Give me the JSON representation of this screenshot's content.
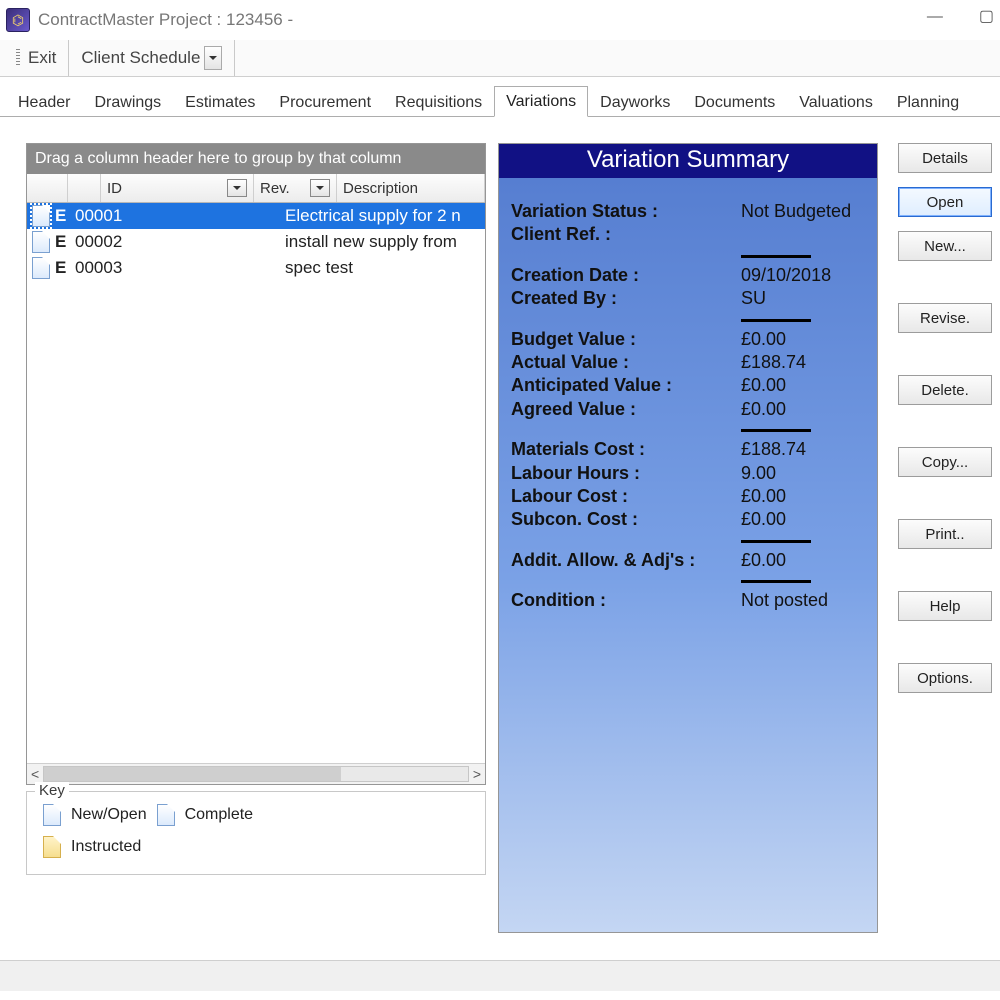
{
  "window": {
    "title": "ContractMaster Project : 123456 -"
  },
  "toolbar": {
    "exit": "Exit",
    "client_schedule": "Client Schedule"
  },
  "tabs": [
    {
      "label": "Header",
      "active": false
    },
    {
      "label": "Drawings",
      "active": false
    },
    {
      "label": "Estimates",
      "active": false
    },
    {
      "label": "Procurement",
      "active": false
    },
    {
      "label": "Requisitions",
      "active": false
    },
    {
      "label": "Variations",
      "active": true
    },
    {
      "label": "Dayworks",
      "active": false
    },
    {
      "label": "Documents",
      "active": false
    },
    {
      "label": "Valuations",
      "active": false
    },
    {
      "label": "Planning",
      "active": false
    }
  ],
  "grid": {
    "group_hint": "Drag a column header here to group by that column",
    "headers": {
      "id": "ID",
      "rev": "Rev.",
      "desc": "Description"
    },
    "rows": [
      {
        "type": "E",
        "id": "00001",
        "desc": "Electrical supply for 2 n",
        "selected": true
      },
      {
        "type": "E",
        "id": "00002",
        "desc": "install new supply from",
        "selected": false
      },
      {
        "type": "E",
        "id": "00003",
        "desc": "spec test",
        "selected": false
      }
    ]
  },
  "key": {
    "legend": "Key",
    "entries": {
      "new_open": "New/Open",
      "complete": "Complete",
      "instructed": "Instructed"
    }
  },
  "summary": {
    "title": "Variation Summary",
    "fields": {
      "status_label": "Variation Status :",
      "status_value": "Not Budgeted",
      "client_ref_label": "Client Ref. :",
      "client_ref_value": "",
      "creation_date_label": "Creation Date :",
      "creation_date_value": "09/10/2018",
      "created_by_label": "Created By :",
      "created_by_value": "SU",
      "budget_value_label": "Budget Value :",
      "budget_value_value": "£0.00",
      "actual_value_label": "Actual Value :",
      "actual_value_value": "£188.74",
      "anticipated_value_label": "Anticipated Value :",
      "anticipated_value_value": "£0.00",
      "agreed_value_label": "Agreed Value :",
      "agreed_value_value": "£0.00",
      "materials_cost_label": "Materials Cost :",
      "materials_cost_value": "£188.74",
      "labour_hours_label": "Labour Hours :",
      "labour_hours_value": "9.00",
      "labour_cost_label": "Labour Cost :",
      "labour_cost_value": "£0.00",
      "subcon_cost_label": "Subcon. Cost :",
      "subcon_cost_value": "£0.00",
      "addit_allow_label": "Addit. Allow. & Adj's :",
      "addit_allow_value": "£0.00",
      "condition_label": "Condition :",
      "condition_value": "Not posted"
    }
  },
  "buttons": {
    "details": "Details",
    "open": "Open",
    "new": "New...",
    "revise": "Revise.",
    "delete": "Delete.",
    "copy": "Copy...",
    "print": "Print..",
    "help": "Help",
    "options": "Options."
  }
}
